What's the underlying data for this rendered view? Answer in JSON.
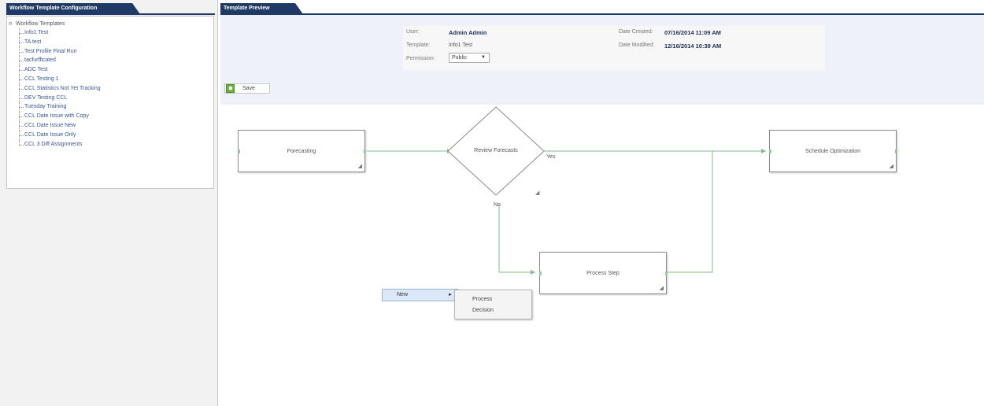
{
  "left_panel": {
    "tab_title": "Workflow Template Configuration",
    "tree": {
      "root_expander": "⊟",
      "root_label": "Workflow Templates",
      "items": [
        "Info1 Test",
        "TA test",
        "Test Profile Final Run",
        "tacfurfficated",
        "ADC Test",
        "CCL Testing 1",
        "CCL Statistics Not Yet Tracking",
        "DEV Testing CCL",
        "Tuesday Training",
        "CCL Date Issue with Copy",
        "CCL Date Issue New",
        "CCL Date Issue Only",
        "CCL 3 Diff Assignments"
      ]
    }
  },
  "right_panel": {
    "tab_title": "Template Preview",
    "info": {
      "user_label": "User:",
      "user_value": "Admin Admin",
      "template_label": "Template:",
      "template_value": "Info1 Test",
      "permission_label": "Permission:",
      "permission_value": "Public",
      "date_created_label": "Date Created:",
      "date_created_value": "07/16/2014 11:09 AM",
      "date_modified_label": "Date Modified:",
      "date_modified_value": "12/16/2014 10:39 AM"
    },
    "save_label": "Save"
  },
  "workflow": {
    "nodes": {
      "forecasting": "Forecasting",
      "review_forecasts": "Review Forecasts",
      "schedule_optimization": "Schedule Optimization",
      "process_step": "Process Step"
    },
    "edge_labels": {
      "yes": "Yes",
      "no": "No"
    },
    "resize_glyph": "◢"
  },
  "context_menu": {
    "new_label": "New",
    "submenu_arrow": "►",
    "items": [
      "Process",
      "Decision"
    ]
  },
  "colors": {
    "tab_navy": "#1f3a64",
    "connector_green": "#7fbf8a",
    "header_bg": "#eef1f7"
  }
}
